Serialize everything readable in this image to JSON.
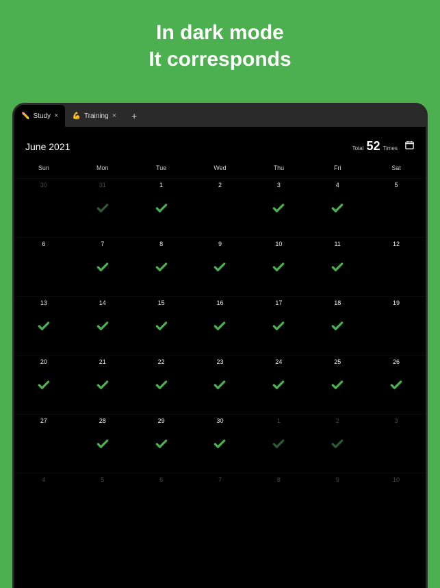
{
  "promo": {
    "line1": "In dark mode",
    "line2": "It corresponds"
  },
  "tabs": [
    {
      "icon": "✏️",
      "label": "Study",
      "active": true
    },
    {
      "icon": "💪",
      "label": "Training",
      "active": false
    }
  ],
  "month_title": "June 2021",
  "stats": {
    "prefix": "Total",
    "count": "52",
    "suffix": "Times"
  },
  "weekdays": [
    "Sun",
    "Mon",
    "Tue",
    "Wed",
    "Thu",
    "Fri",
    "Sat"
  ],
  "days": [
    {
      "n": "30",
      "muted": true,
      "check": false
    },
    {
      "n": "31",
      "muted": true,
      "check": true,
      "checkMuted": true
    },
    {
      "n": "1",
      "check": true
    },
    {
      "n": "2",
      "check": false
    },
    {
      "n": "3",
      "check": true
    },
    {
      "n": "4",
      "check": true
    },
    {
      "n": "5",
      "check": false
    },
    {
      "n": "6",
      "check": false
    },
    {
      "n": "7",
      "check": true
    },
    {
      "n": "8",
      "check": true
    },
    {
      "n": "9",
      "check": true
    },
    {
      "n": "10",
      "check": true
    },
    {
      "n": "11",
      "check": true
    },
    {
      "n": "12",
      "check": false
    },
    {
      "n": "13",
      "check": true
    },
    {
      "n": "14",
      "check": true
    },
    {
      "n": "15",
      "check": true
    },
    {
      "n": "16",
      "check": true
    },
    {
      "n": "17",
      "check": true
    },
    {
      "n": "18",
      "check": true
    },
    {
      "n": "19",
      "check": false
    },
    {
      "n": "20",
      "check": true
    },
    {
      "n": "21",
      "check": true
    },
    {
      "n": "22",
      "check": true
    },
    {
      "n": "23",
      "check": true
    },
    {
      "n": "24",
      "check": true
    },
    {
      "n": "25",
      "check": true
    },
    {
      "n": "26",
      "check": true
    },
    {
      "n": "27",
      "check": false
    },
    {
      "n": "28",
      "check": true
    },
    {
      "n": "29",
      "check": true
    },
    {
      "n": "30",
      "check": true
    },
    {
      "n": "1",
      "muted": true,
      "check": true,
      "checkMuted": true
    },
    {
      "n": "2",
      "muted": true,
      "check": true,
      "checkMuted": true
    },
    {
      "n": "3",
      "muted": true,
      "check": false
    },
    {
      "n": "4",
      "muted": true,
      "check": false
    },
    {
      "n": "5",
      "muted": true,
      "check": false
    },
    {
      "n": "6",
      "muted": true,
      "check": false
    },
    {
      "n": "7",
      "muted": true,
      "check": false
    },
    {
      "n": "8",
      "muted": true,
      "check": false
    },
    {
      "n": "9",
      "muted": true,
      "check": false
    },
    {
      "n": "10",
      "muted": true,
      "check": false
    }
  ],
  "colors": {
    "bg": "#4CAF50",
    "check": "#4CAF50"
  }
}
